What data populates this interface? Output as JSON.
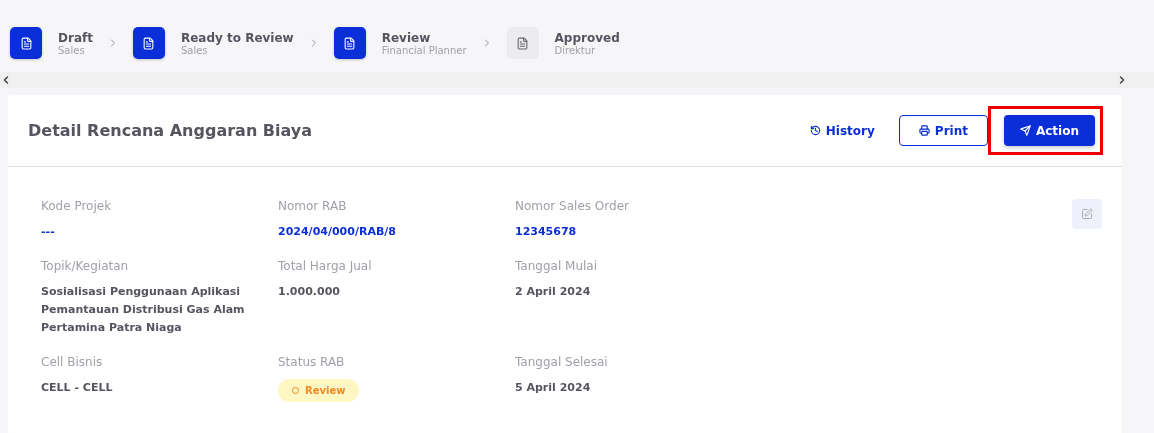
{
  "steps": [
    {
      "title": "Draft",
      "subtitle": "Sales",
      "done": true
    },
    {
      "title": "Ready to Review",
      "subtitle": "Sales",
      "done": true
    },
    {
      "title": "Review",
      "subtitle": "Financial Planner",
      "done": true
    },
    {
      "title": "Approved",
      "subtitle": "Direktur",
      "done": false
    }
  ],
  "card": {
    "title": "Detail Rencana Anggaran Biaya",
    "actions": [
      {
        "label": "History",
        "kind": "link",
        "highlighted": false
      },
      {
        "label": "Print",
        "kind": "outline",
        "highlighted": false
      },
      {
        "label": "Action",
        "kind": "primary",
        "highlighted": true
      }
    ],
    "fields": [
      {
        "label": "Kode Projek",
        "value": "---",
        "kind": "link"
      },
      {
        "label": "Nomor RAB",
        "value": "2024/04/000/RAB/8",
        "kind": "link"
      },
      {
        "label": "Nomor Sales Order",
        "value": "12345678",
        "kind": "link"
      },
      {
        "label": "Topik/Kegiatan",
        "value": "Sosialisasi Penggunaan Aplikasi Pemantauan Distribusi Gas Alam Pertamina Patra Niaga",
        "kind": "text"
      },
      {
        "label": "Total Harga Jual",
        "value": "1.000.000",
        "kind": "text"
      },
      {
        "label": "Tanggal Mulai",
        "value": "2 April 2024",
        "kind": "text"
      },
      {
        "label": "Cell Bisnis",
        "value": "CELL - CELL",
        "kind": "text"
      },
      {
        "label": "Status RAB",
        "value": "Review",
        "kind": "badge"
      },
      {
        "label": "Tanggal Selesai",
        "value": "5 April 2024",
        "kind": "text"
      }
    ]
  }
}
